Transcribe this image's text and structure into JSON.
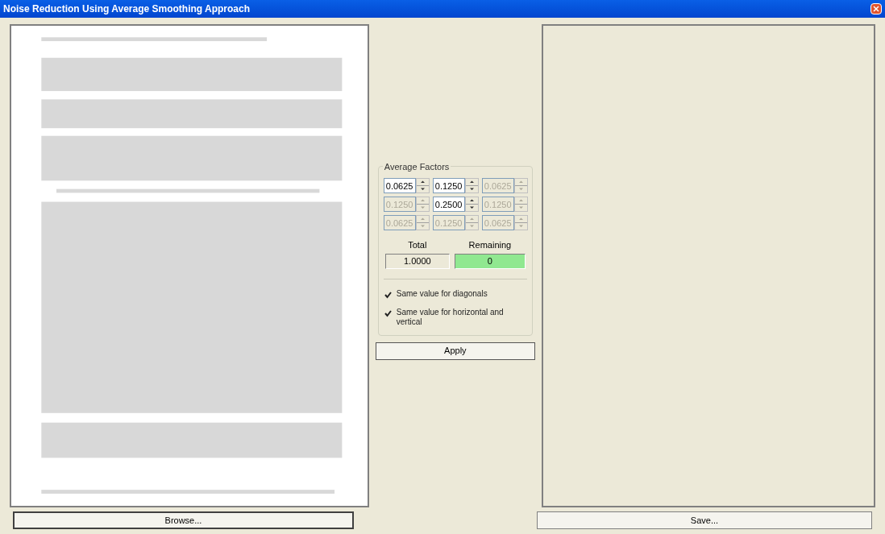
{
  "window": {
    "title": "Noise Reduction Using Average Smoothing Approach"
  },
  "average_factors": {
    "title": "Average Factors",
    "grid": [
      [
        {
          "value": "0.0625",
          "disabled": false
        },
        {
          "value": "0.1250",
          "disabled": false
        },
        {
          "value": "0.0625",
          "disabled": true
        }
      ],
      [
        {
          "value": "0.1250",
          "disabled": true
        },
        {
          "value": "0.2500",
          "disabled": false
        },
        {
          "value": "0.1250",
          "disabled": true
        }
      ],
      [
        {
          "value": "0.0625",
          "disabled": true
        },
        {
          "value": "0.1250",
          "disabled": true
        },
        {
          "value": "0.0625",
          "disabled": true
        }
      ]
    ],
    "total": {
      "label": "Total",
      "value": "1.0000"
    },
    "remaining": {
      "label": "Remaining",
      "value": "0",
      "ok": true
    },
    "options": [
      {
        "label": "Same value for diagonals",
        "checked": true
      },
      {
        "label": "Same value for horizontal and vertical",
        "checked": true
      }
    ]
  },
  "apply_button": "Apply",
  "browse_button": "Browse...",
  "save_button": "Save..."
}
